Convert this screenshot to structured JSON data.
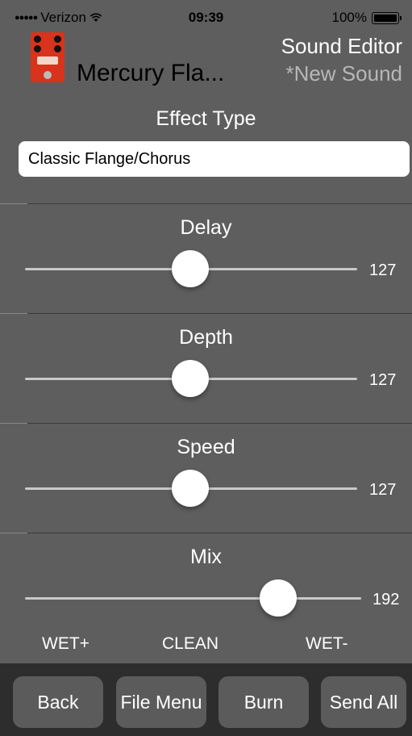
{
  "status_bar": {
    "carrier": "Verizon",
    "time": "09:39",
    "battery": "100%"
  },
  "header": {
    "preset_name": "Mercury Fla...",
    "app_title": "Sound Editor",
    "sound_name": "*New Sound"
  },
  "effect": {
    "label": "Effect Type",
    "value": "Classic Flange/Chorus"
  },
  "params": [
    {
      "label": "Delay",
      "value": "127",
      "level": 127,
      "max": 255
    },
    {
      "label": "Depth",
      "value": "127",
      "level": 127,
      "max": 255
    },
    {
      "label": "Speed",
      "value": "127",
      "level": 127,
      "max": 255
    },
    {
      "label": "Mix",
      "value": "192",
      "level": 192,
      "max": 255
    }
  ],
  "mix_labels": {
    "left": "WET+",
    "center": "CLEAN",
    "right": "WET-"
  },
  "toolbar": {
    "back": "Back",
    "file_menu": "File Menu",
    "burn": "Burn",
    "send_all": "Send All"
  },
  "colors": {
    "background": "#5e5e5e",
    "toolbar": "#2d2d2d",
    "button": "#5b5b5b"
  }
}
